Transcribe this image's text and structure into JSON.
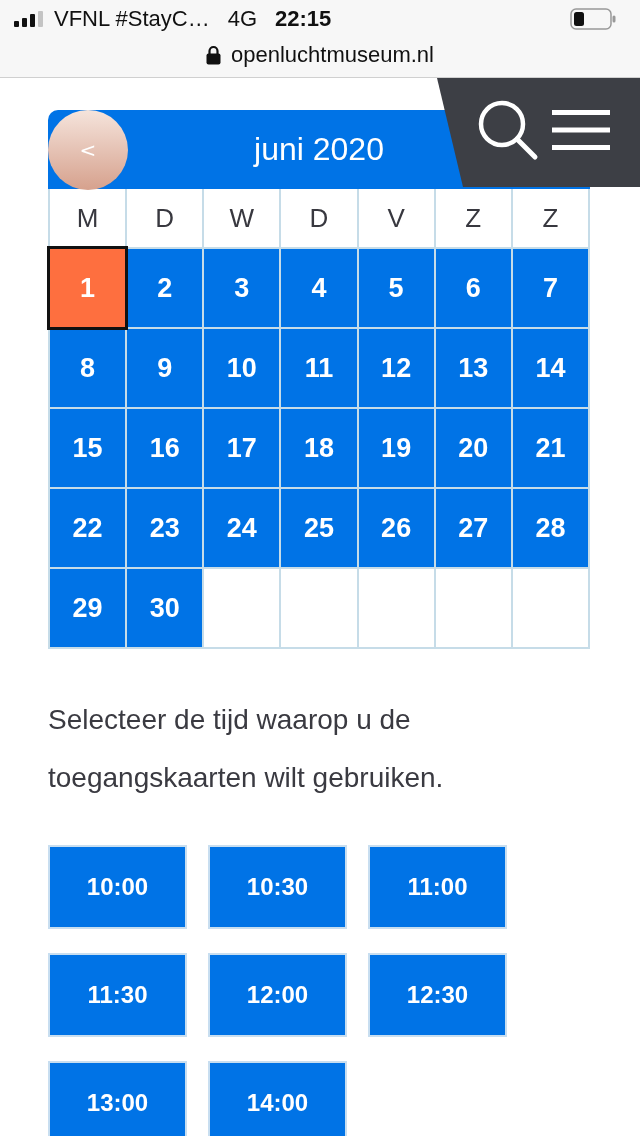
{
  "status_bar": {
    "carrier": "VFNL #StayC…",
    "network": "4G",
    "time": "22:15"
  },
  "address_bar": {
    "url": "openluchtmuseum.nl"
  },
  "calendar": {
    "prev_button": "<",
    "month": "juni 2020",
    "weekdays": [
      "M",
      "D",
      "W",
      "D",
      "V",
      "Z",
      "Z"
    ],
    "days": [
      {
        "label": "1",
        "selected": true
      },
      {
        "label": "2",
        "selected": false
      },
      {
        "label": "3",
        "selected": false
      },
      {
        "label": "4",
        "selected": false
      },
      {
        "label": "5",
        "selected": false
      },
      {
        "label": "6",
        "selected": false
      },
      {
        "label": "7",
        "selected": false
      },
      {
        "label": "8",
        "selected": false
      },
      {
        "label": "9",
        "selected": false
      },
      {
        "label": "10",
        "selected": false
      },
      {
        "label": "11",
        "selected": false
      },
      {
        "label": "12",
        "selected": false
      },
      {
        "label": "13",
        "selected": false
      },
      {
        "label": "14",
        "selected": false
      },
      {
        "label": "15",
        "selected": false
      },
      {
        "label": "16",
        "selected": false
      },
      {
        "label": "17",
        "selected": false
      },
      {
        "label": "18",
        "selected": false
      },
      {
        "label": "19",
        "selected": false
      },
      {
        "label": "20",
        "selected": false
      },
      {
        "label": "21",
        "selected": false
      },
      {
        "label": "22",
        "selected": false
      },
      {
        "label": "23",
        "selected": false
      },
      {
        "label": "24",
        "selected": false
      },
      {
        "label": "25",
        "selected": false
      },
      {
        "label": "26",
        "selected": false
      },
      {
        "label": "27",
        "selected": false
      },
      {
        "label": "28",
        "selected": false
      },
      {
        "label": "29",
        "selected": false
      },
      {
        "label": "30",
        "selected": false
      }
    ]
  },
  "instruction": "Selecteer de tijd waarop u de toegangskaarten wilt gebruiken.",
  "time_slots": [
    "10:00",
    "10:30",
    "11:00",
    "11:30",
    "12:00",
    "12:30",
    "13:00",
    "14:00"
  ]
}
